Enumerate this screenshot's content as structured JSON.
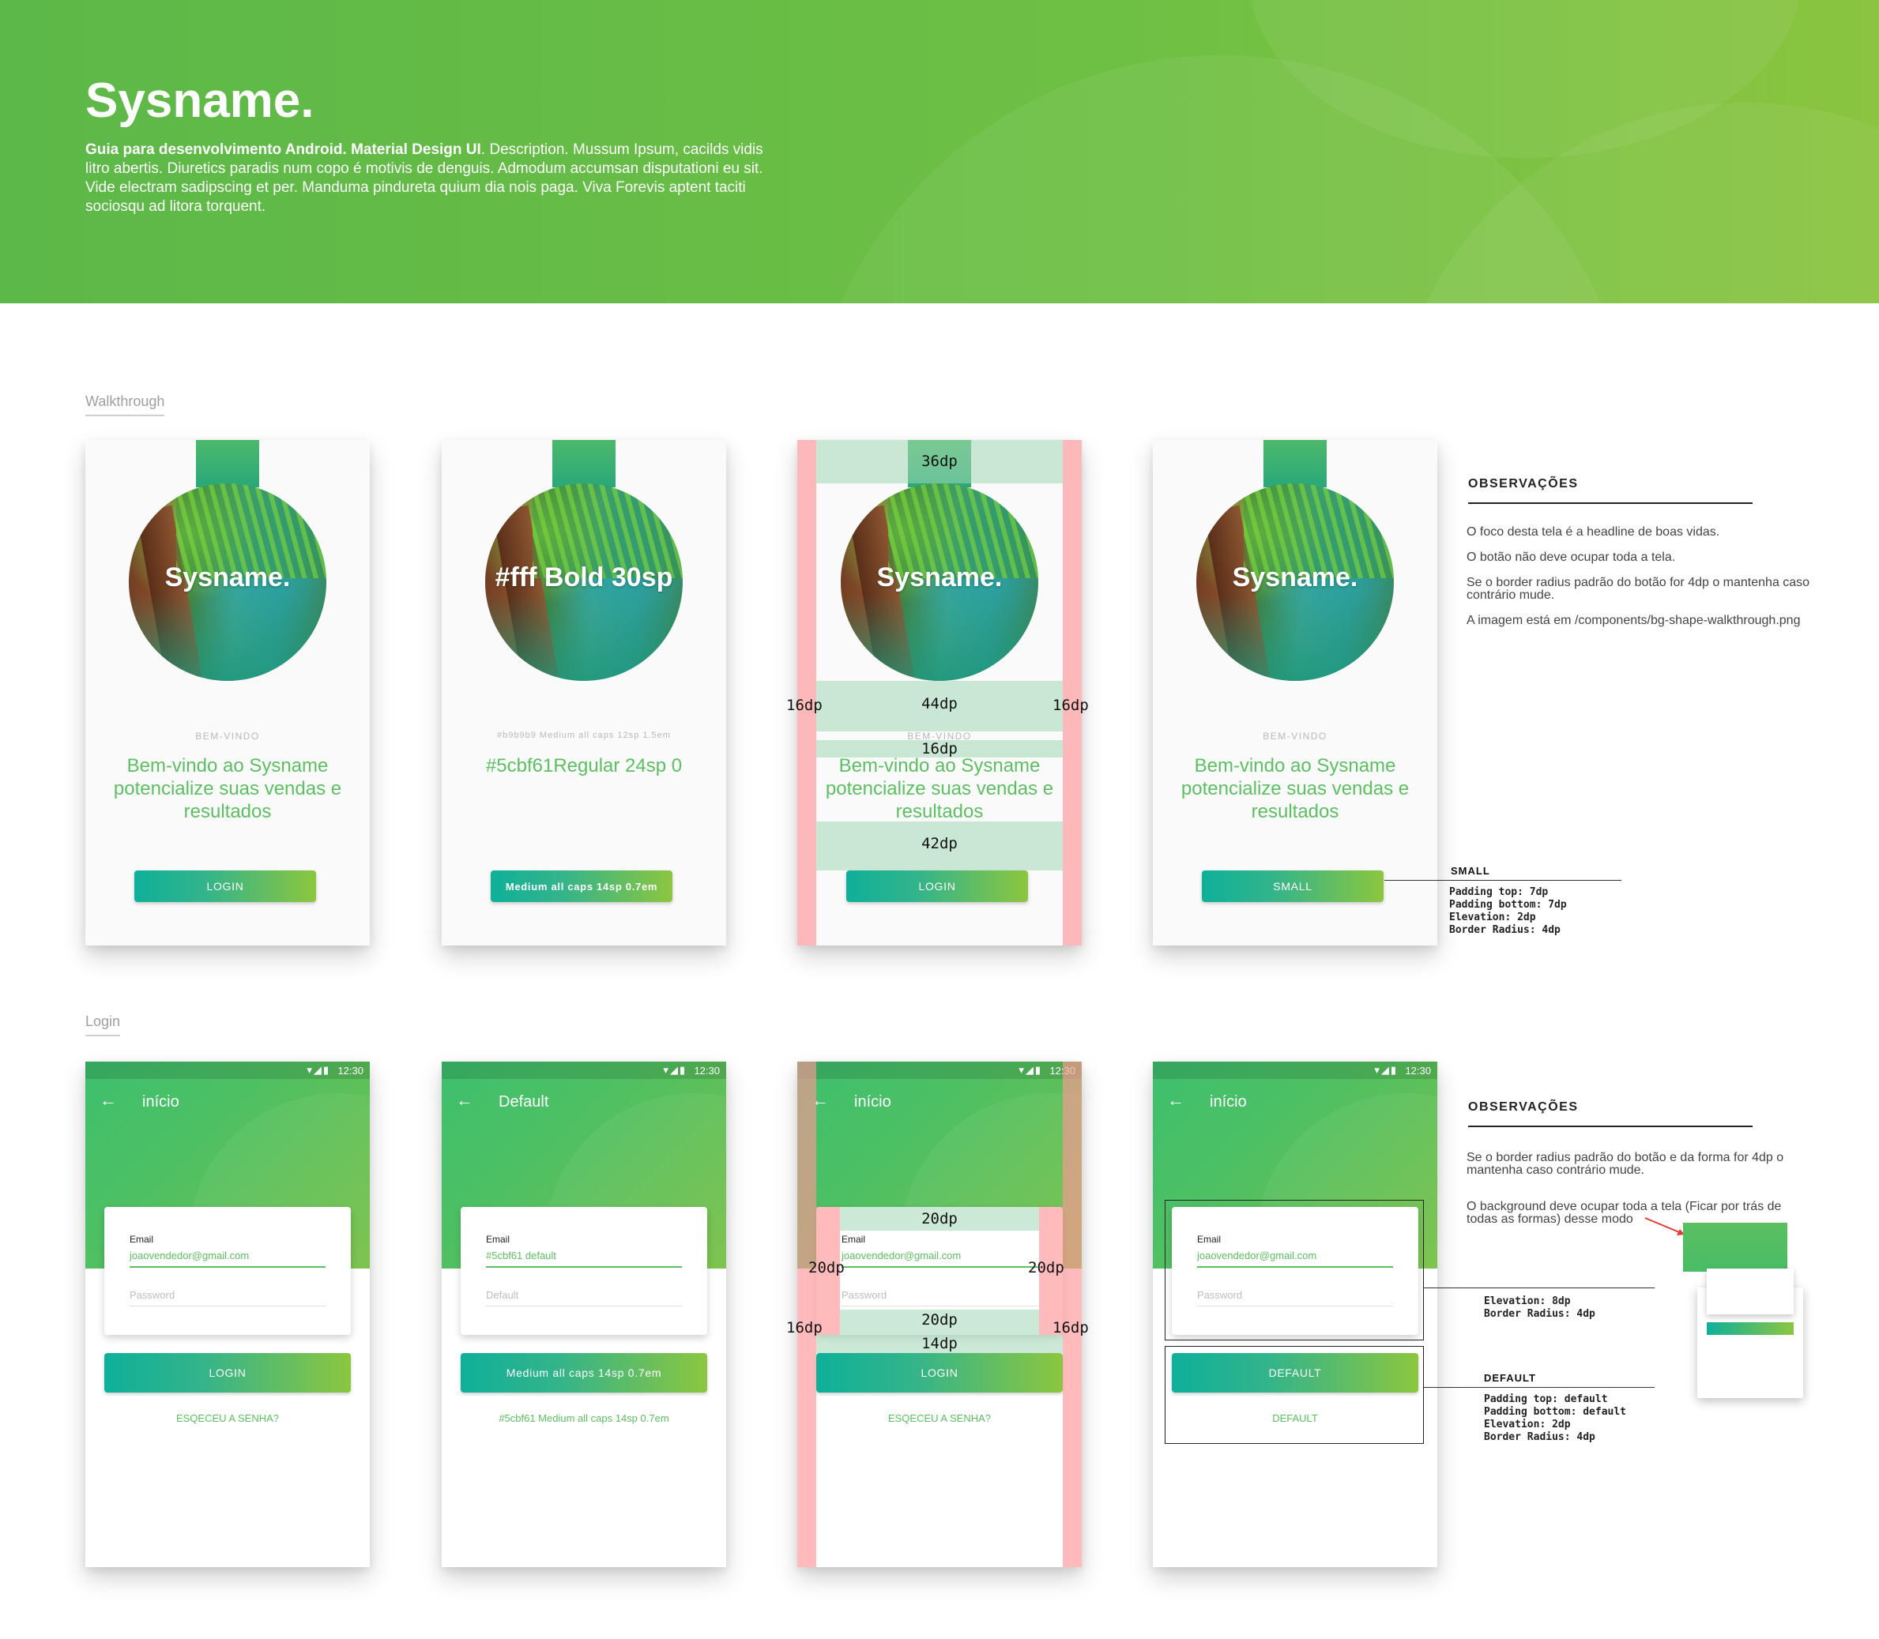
{
  "header": {
    "title": "Sysname.",
    "desc_bold": "Guia para desenvolvimento Android. Material Design UI",
    "desc_rest": ". Description. Mussum Ipsum, cacilds vidis litro abertis. Diuretics paradis num copo é motivis de denguis. Admodum accumsan disputationi eu sit. Vide electram sadipscing et per. Manduma pindureta quium dia nois paga. Viva Forevis aptent taciti sociosqu ad litora torquent."
  },
  "sections": {
    "walkthrough": "Walkthrough",
    "login": "Login"
  },
  "walkthrough": {
    "cards": [
      {
        "brand": "Sysname.",
        "kicker": "BEM-VINDO",
        "headline": "Bem-vindo ao Sysname potencialize suas vendas e resultados",
        "button": "LOGIN"
      },
      {
        "brand": "#fff Bold 30sp",
        "kicker": "#b9b9b9 Medium all caps 12sp 1.5em",
        "headline": "#5cbf61Regular 24sp 0",
        "button": "Medium all caps 14sp 0.7em"
      },
      {
        "brand": "Sysname.",
        "kicker": "BEM-VINDO",
        "headline": "Bem-vindo ao Sysname potencialize suas vendas e resultados",
        "button": "LOGIN"
      },
      {
        "brand": "Sysname.",
        "kicker": "BEM-VINDO",
        "headline": "Bem-vindo ao Sysname potencialize suas vendas e resultados",
        "button": "SMALL"
      }
    ],
    "measures": {
      "top": "36dp",
      "mid": "44dp",
      "gap": "16dp",
      "bottom": "42dp",
      "left": "16dp",
      "right": "16dp"
    },
    "notes": {
      "title": "OBSERVAÇÕES",
      "items": [
        "O foco desta tela é a headline de boas vidas.",
        "O botão não deve ocupar toda a tela.",
        "Se o border radius padrão do botão for 4dp o mantenha caso contrário mude.",
        "A imagem está em /components/bg-shape-walkthrough.png"
      ]
    },
    "small_spec": {
      "title": "SMALL",
      "lines": [
        "Padding top: 7dp",
        "Padding bottom: 7dp",
        "Elevation: 2dp",
        "Border Radius: 4dp"
      ]
    }
  },
  "login": {
    "status_time": "12:30",
    "cards": [
      {
        "title": "início",
        "email_label": "Email",
        "email_value": "joaovendedor@gmail.com",
        "password": "Password",
        "button": "LOGIN",
        "link": "ESQECEU A SENHA?"
      },
      {
        "title": "Default",
        "email_label": "Email",
        "email_value": "#5cbf61 default",
        "password": "Default",
        "button": "Medium all caps 14sp 0.7em",
        "link": "#5cbf61 Medium all caps 14sp 0.7em"
      },
      {
        "title": "início",
        "email_label": "Email",
        "email_value": "joaovendedor@gmail.com",
        "password": "Password",
        "button": "LOGIN",
        "link": "ESQECEU A SENHA?"
      },
      {
        "title": "início",
        "email_label": "Email",
        "email_value": "joaovendedor@gmail.com",
        "password": "Password",
        "button": "DEFAULT",
        "link": "DEFAULT"
      }
    ],
    "measures": {
      "top": "20dp",
      "left": "20dp",
      "right": "20dp",
      "bottom": "20dp",
      "gap": "14dp",
      "outer_left": "16dp",
      "outer_right": "16dp"
    },
    "notes": {
      "title": "OBSERVAÇÕES",
      "items": [
        "Se o border radius padrão do botão e da forma for 4dp o mantenha caso contrário mude.",
        "O background deve ocupar toda a tela (Ficar por trás de todas as formas) desse modo"
      ]
    },
    "form_spec": {
      "lines": [
        "Elevation: 8dp",
        "Border Radius: 4dp"
      ]
    },
    "default_spec": {
      "title": "DEFAULT",
      "lines": [
        "Padding top: default",
        "Padding bottom: default",
        "Elevation: 2dp",
        "Border Radius: 4dp"
      ]
    }
  },
  "colors": {
    "brand_green": "#5cbf61",
    "kicker_gray": "#b9b9b9",
    "gradient_start": "#0eb09a",
    "gradient_end": "#8cc63f"
  }
}
